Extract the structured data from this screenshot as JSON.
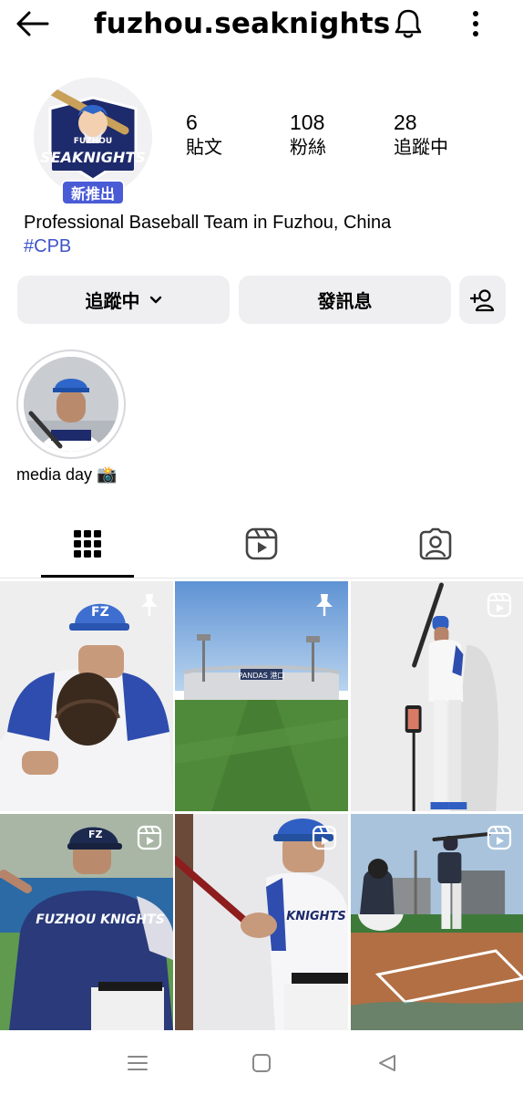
{
  "header": {
    "username": "fuzhou.seaknights"
  },
  "profile": {
    "badge": "新推出",
    "logo_text_top": "FUZHOU",
    "logo_text_main": "SEAKNIGHTS",
    "stats": [
      {
        "value": "6",
        "label": "貼文"
      },
      {
        "value": "108",
        "label": "粉絲"
      },
      {
        "value": "28",
        "label": "追蹤中"
      }
    ],
    "bio": "Professional Baseball Team in Fuzhou, China",
    "hashtag": "#CPB"
  },
  "actions": {
    "following_label": "追蹤中",
    "message_label": "發訊息"
  },
  "highlights": [
    {
      "label": "media day 📸"
    }
  ],
  "grid_posts": [
    {
      "overlay": "pin-icon"
    },
    {
      "overlay": "pin-icon",
      "sign": "PANDAS 港口"
    },
    {
      "overlay": "reel-icon"
    },
    {
      "overlay": "reel-icon",
      "jersey": "FUZHOU KNIGHTS"
    },
    {
      "overlay": "reel-icon",
      "jersey": "KNIGHTS"
    },
    {
      "overlay": "reel-icon"
    }
  ],
  "colors": {
    "accent_blue": "#3d54c9",
    "badge_blue": "#4a5bd6",
    "button_bg": "#efeff1",
    "team_navy": "#1d2a6b"
  }
}
